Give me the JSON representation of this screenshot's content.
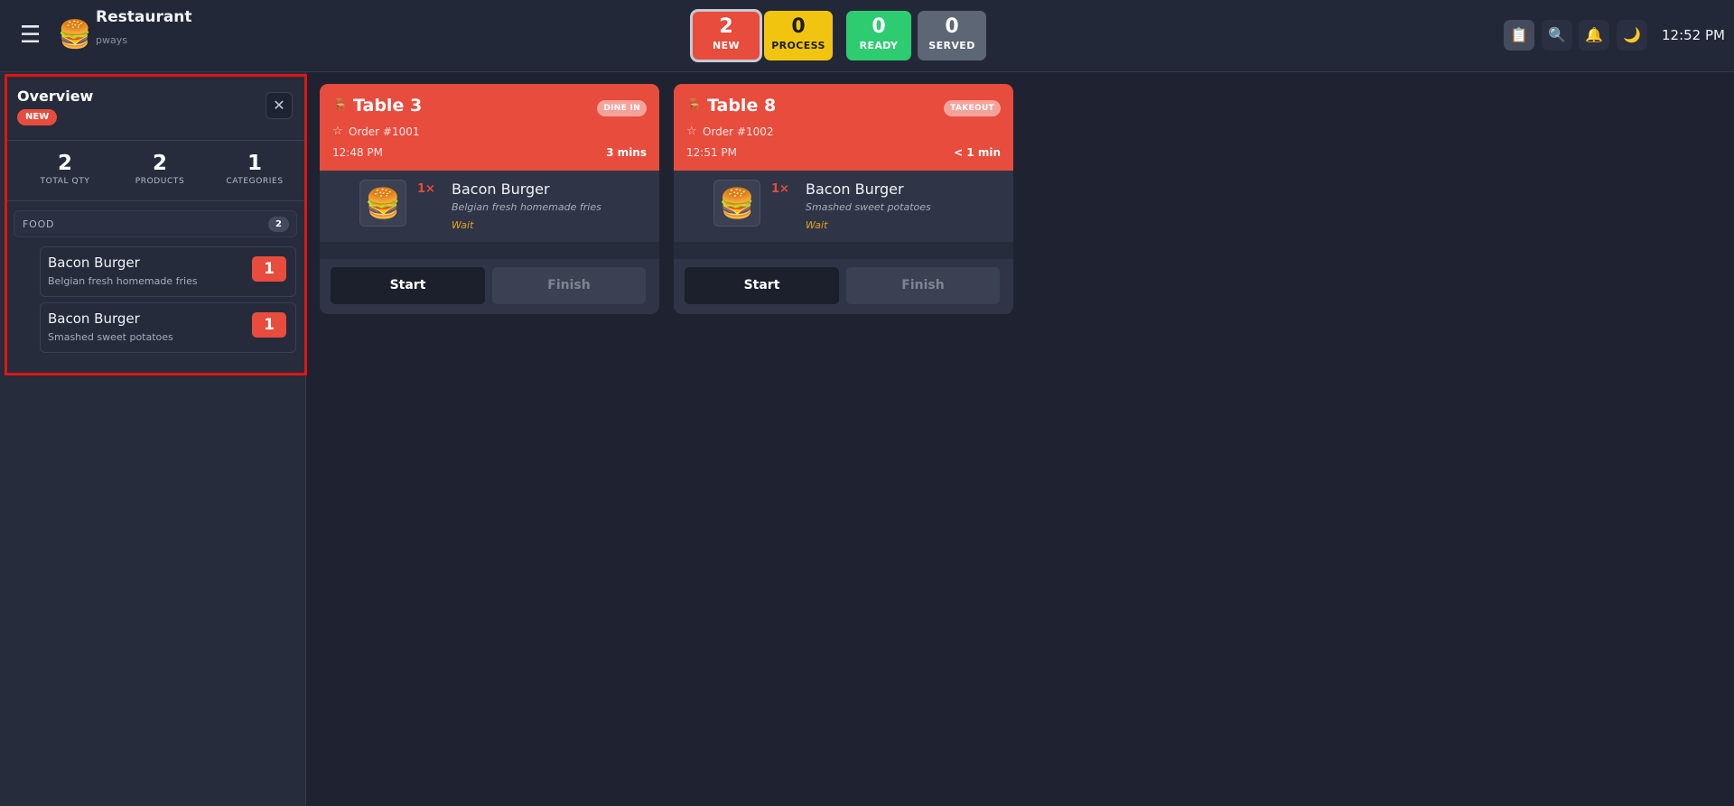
{
  "header": {
    "app_title": "Restaurant",
    "app_subtitle": "pways",
    "logo": "burger-logo",
    "clock": "12:52 PM",
    "status_tiles": [
      {
        "count": "2",
        "label": "NEW"
      },
      {
        "count": "0",
        "label": "PROCESS"
      },
      {
        "count": "0",
        "label": "READY"
      },
      {
        "count": "0",
        "label": "SERVED"
      }
    ],
    "buttons": [
      "clipboard-icon",
      "search-icon",
      "bell-icon",
      "moon-icon"
    ]
  },
  "overview": {
    "title": "Overview",
    "badge": "NEW",
    "close_label": "✕",
    "stats": [
      {
        "value": "2",
        "label": "TOTAL QTY"
      },
      {
        "value": "2",
        "label": "PRODUCTS"
      },
      {
        "value": "1",
        "label": "CATEGORIES"
      }
    ],
    "category": {
      "name": "FOOD",
      "count": "2"
    },
    "products": [
      {
        "name": "Bacon Burger",
        "desc": "Belgian fresh homemade fries",
        "qty": "1"
      },
      {
        "name": "Bacon Burger",
        "desc": "Smashed sweet potatoes",
        "qty": "1"
      }
    ]
  },
  "orders": [
    {
      "table": "Table 3",
      "type": "DINE IN",
      "order_no": "Order #1001",
      "time": "12:48 PM",
      "elapsed": "3 mins",
      "item": {
        "qty": "1×",
        "name": "Bacon Burger",
        "desc": "Belgian fresh homemade fries",
        "status": "Wait"
      },
      "start_label": "Start",
      "finish_label": "Finish"
    },
    {
      "table": "Table 8",
      "type": "TAKEOUT",
      "order_no": "Order #1002",
      "time": "12:51 PM",
      "elapsed": "< 1 min",
      "item": {
        "qty": "1×",
        "name": "Bacon Burger",
        "desc": "Smashed sweet potatoes",
        "status": "Wait"
      },
      "start_label": "Start",
      "finish_label": "Finish"
    }
  ],
  "colors": {
    "new": "#e74c3c",
    "process": "#f1c40f",
    "ready": "#2ecc71",
    "served": "#5c6674",
    "background": "#1e2231"
  }
}
